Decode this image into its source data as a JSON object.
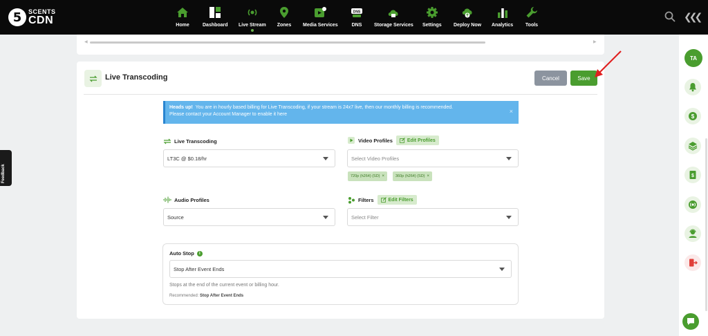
{
  "brand": {
    "badge": "5",
    "line1": "SCENTS",
    "line2": "CDN"
  },
  "nav": [
    {
      "label": "Home",
      "icon": "home-icon"
    },
    {
      "label": "Dashboard",
      "icon": "dashboard-icon"
    },
    {
      "label": "Live Stream",
      "icon": "broadcast-icon",
      "active": true
    },
    {
      "label": "Zones",
      "icon": "map-pin-icon"
    },
    {
      "label": "Media Services",
      "icon": "media-icon"
    },
    {
      "label": "DNS",
      "icon": "dns-icon"
    },
    {
      "label": "Storage Services",
      "icon": "cloud-icon"
    },
    {
      "label": "Settings",
      "icon": "gear-icon"
    },
    {
      "label": "Deploy Now",
      "icon": "deploy-icon"
    },
    {
      "label": "Analytics",
      "icon": "bar-chart-icon"
    },
    {
      "label": "Tools",
      "icon": "wrench-icon"
    }
  ],
  "dns_icon_text": "DNS",
  "user": {
    "initials": "TA"
  },
  "feedback_label": "Feedback",
  "page": {
    "title": "Live Transcoding",
    "cancel_label": "Cancel",
    "save_label": "Save"
  },
  "alert": {
    "heading": "Heads up!",
    "line1": "You are in hourly based billing for Live Transcoding, if your stream is 24x7 live, then our monthly billing is recommended.",
    "line2": "Please contact your Account Manager to enable it here",
    "close": "×"
  },
  "form": {
    "live_transcoding": {
      "label": "Live Transcoding",
      "value": "LT3C @ $0.18/hr"
    },
    "video_profiles": {
      "label": "Video Profiles",
      "edit_label": "Edit Profiles",
      "placeholder": "Select Video Profiles",
      "tags": [
        "720p (h264) (SD)",
        "360p (h264) (SD)"
      ]
    },
    "audio_profiles": {
      "label": "Audio Profiles",
      "value": "Source"
    },
    "filters": {
      "label": "Filters",
      "edit_label": "Edit Filters",
      "placeholder": "Select Filter"
    }
  },
  "auto_stop": {
    "title": "Auto Stop",
    "info": "i",
    "value": "Stop After Event Ends",
    "help": "Stops at the end of the current event or billing hour.",
    "rec_prefix": "Recommended:",
    "rec_value": "Stop After Event Ends"
  },
  "colors": {
    "accent": "#4a9d2f",
    "nav_bg": "#0a0a0a",
    "alert_bg": "#63b5ec",
    "cancel": "#8c949f",
    "arrow": "#e02020"
  }
}
